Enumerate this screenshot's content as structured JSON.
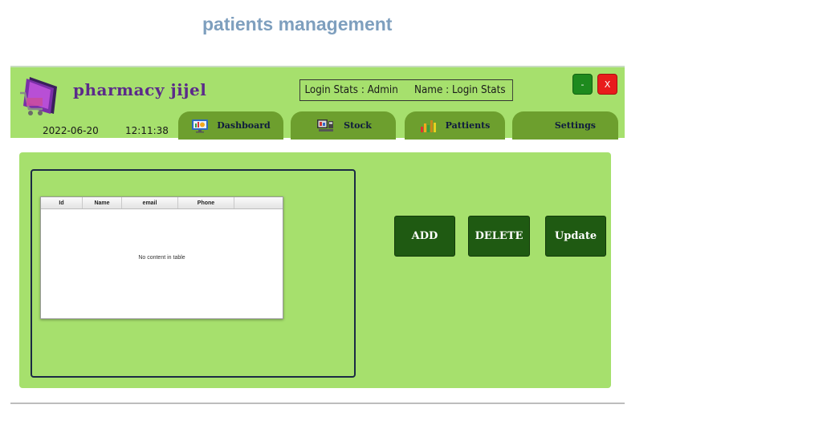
{
  "page_heading": "patients management",
  "app": {
    "title": "pharmacy jijel",
    "logo_icon": "shopping-cart-logo-icon"
  },
  "login": {
    "stats": "Login Stats :  Admin",
    "name": "Name :  Login Stats"
  },
  "window_controls": {
    "minimize": "-",
    "close": "X"
  },
  "clock": {
    "date": "2022-06-20",
    "time": "12:11:38"
  },
  "tabs": [
    {
      "label": "Dashboard",
      "icon": "dashboard-icon"
    },
    {
      "label": "Stock",
      "icon": "stock-icon"
    },
    {
      "label": "Pattients",
      "icon": "bar-chart-icon"
    },
    {
      "label": "Settings",
      "icon": ""
    }
  ],
  "table": {
    "columns": [
      "Id",
      "Name",
      "email",
      "Phone"
    ],
    "rows": [],
    "empty_text": "No content in table"
  },
  "actions": {
    "add": "ADD",
    "delete": "DELETE",
    "update": "Update"
  },
  "colors": {
    "header_bg": "#a6e06d",
    "tab_bg": "#6d9f2e",
    "button_bg": "#1f5a12",
    "title": "#5b2a8a",
    "heading": "#7e9fbe"
  }
}
